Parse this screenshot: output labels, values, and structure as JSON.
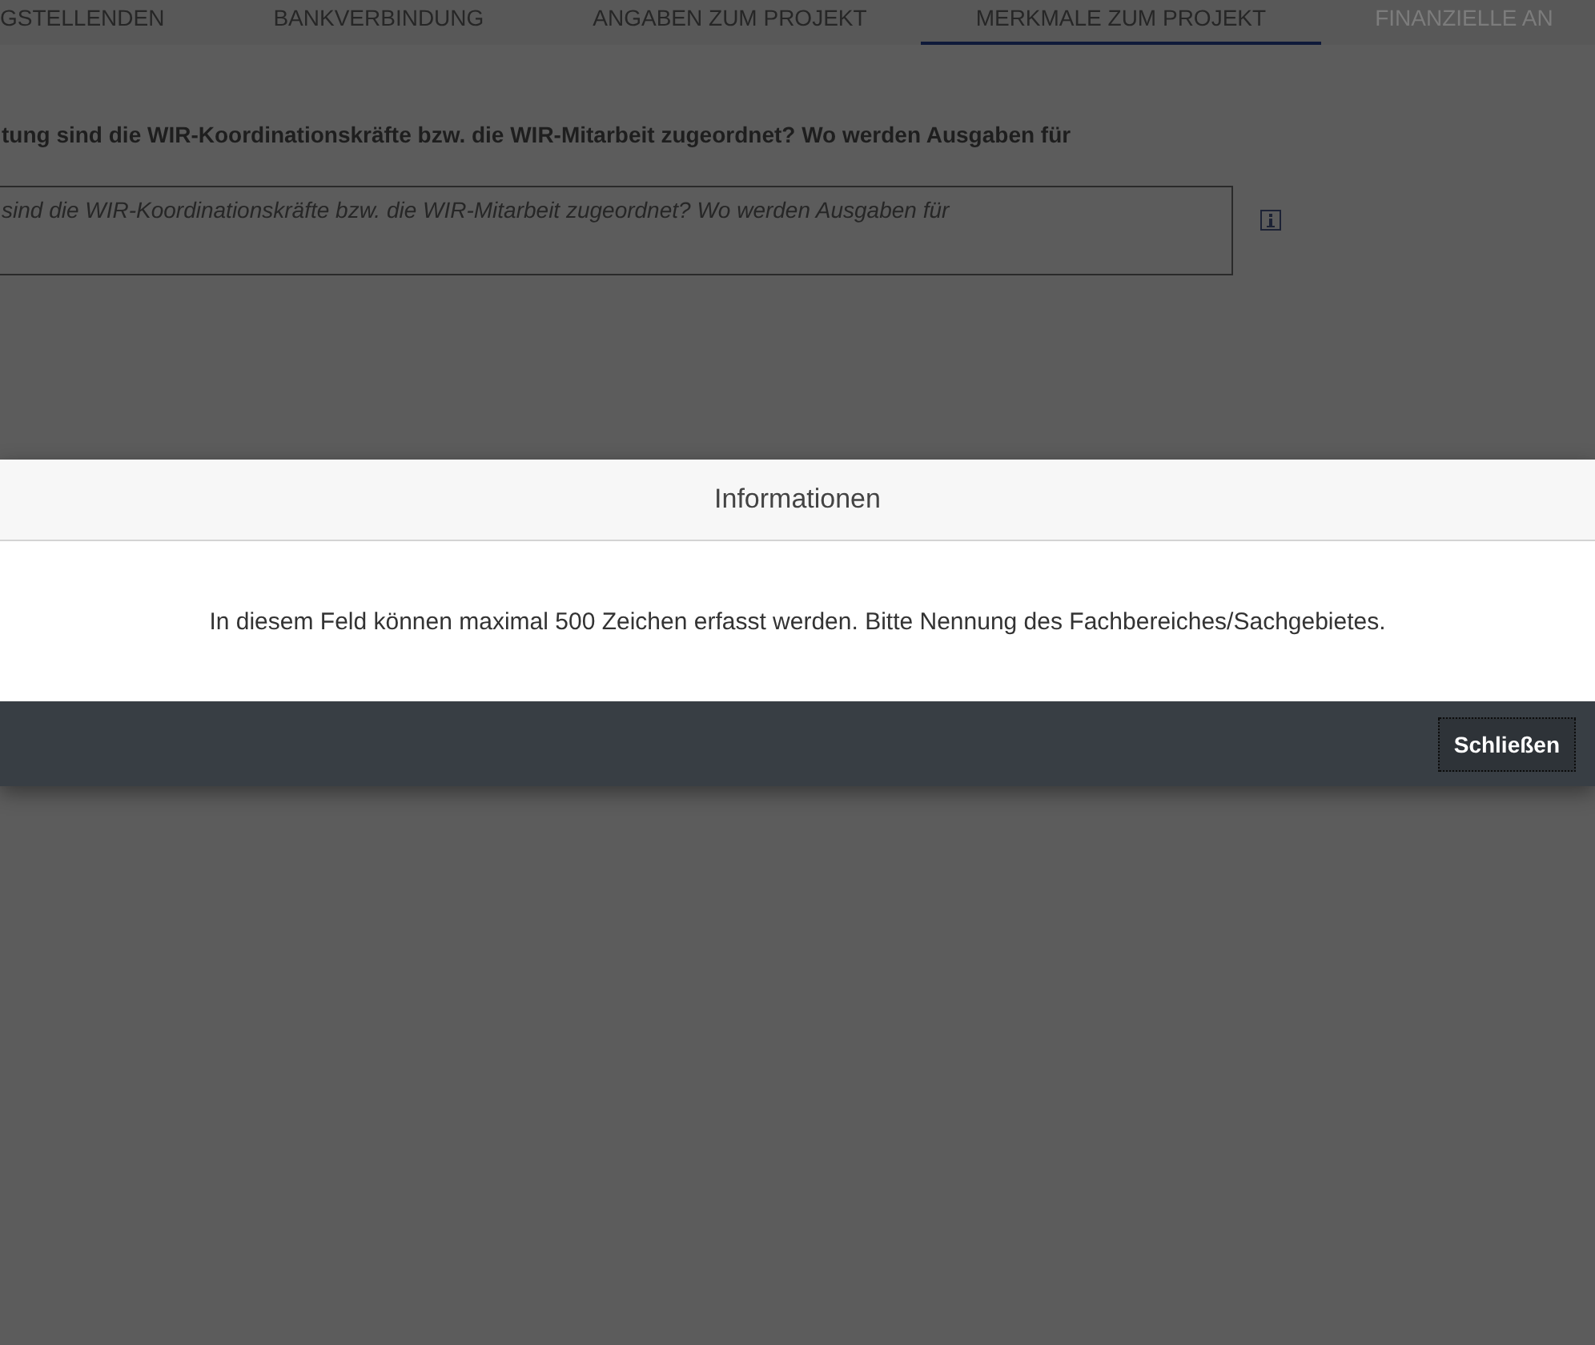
{
  "tabs": [
    {
      "label": "GSTELLENDEN",
      "selected": false,
      "disabled": false
    },
    {
      "label": "BANKVERBINDUNG",
      "selected": false,
      "disabled": false
    },
    {
      "label": "ANGABEN ZUM PROJEKT",
      "selected": false,
      "disabled": false
    },
    {
      "label": "MERKMALE ZUM PROJEKT",
      "selected": true,
      "disabled": false
    },
    {
      "label": "FINANZIELLE AN",
      "selected": false,
      "disabled": true
    }
  ],
  "question": {
    "label": "tung sind die WIR-Koordinationskräfte bzw. die WIR-Mitarbeit zugeordnet? Wo werden Ausgaben für",
    "placeholder": "sind die WIR-Koordinationskräfte bzw. die WIR-Mitarbeit zugeordnet? Wo werden Ausgaben für"
  },
  "dialog": {
    "title": "Informationen",
    "message": "In diesem Feld können maximal 500 Zeichen erfasst werden. Bitte Nennung des Fachbereiches/Sachgebietes.",
    "button": "Schließen"
  }
}
